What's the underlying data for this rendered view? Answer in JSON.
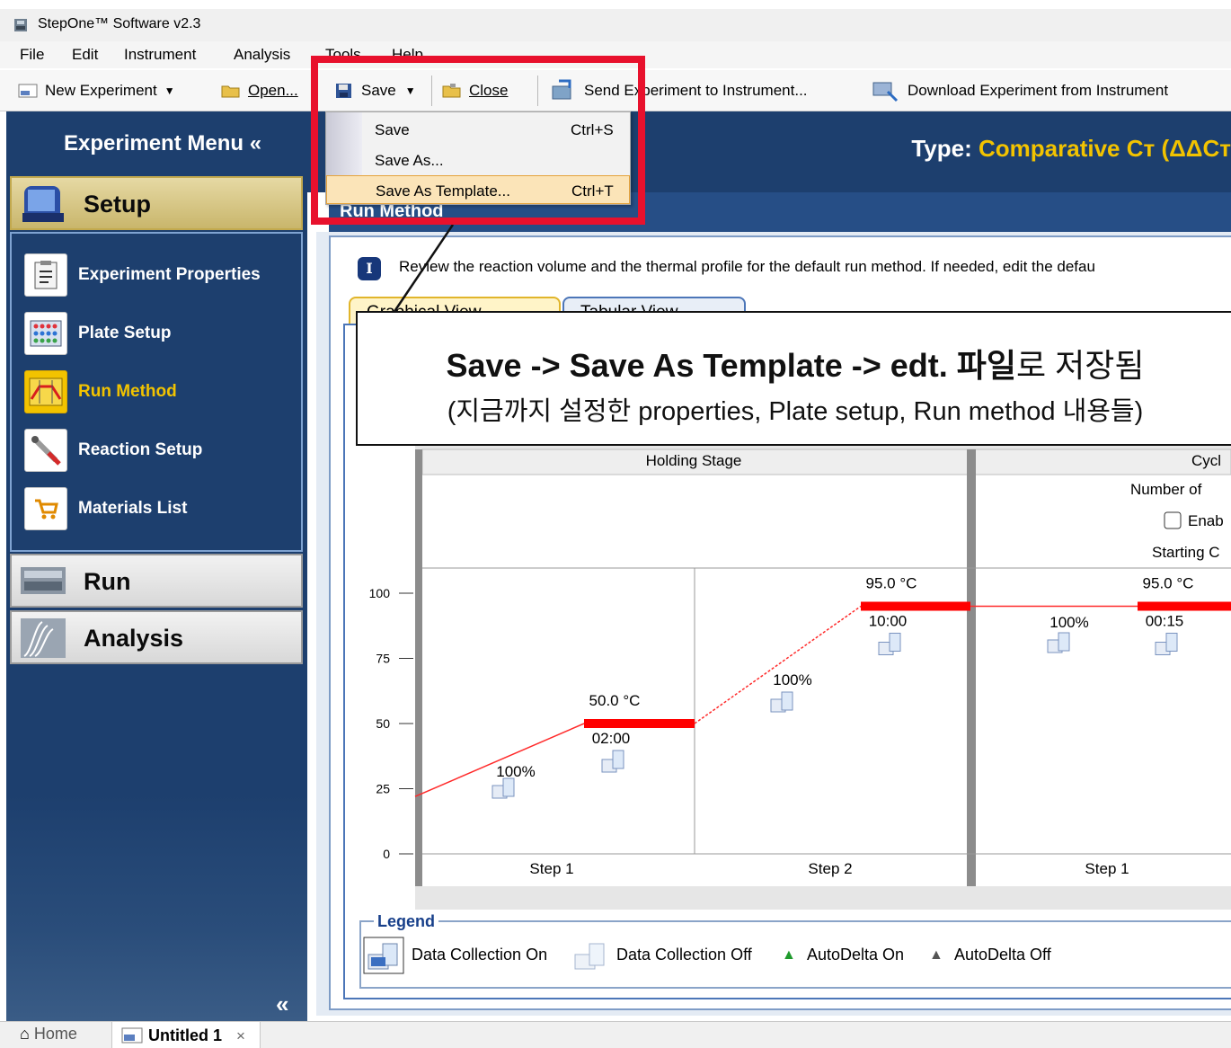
{
  "window": {
    "title": "StepOne™ Software v2.3"
  },
  "menubar": {
    "items": [
      "File",
      "Edit",
      "Instrument",
      "Analysis",
      "Tools",
      "Help"
    ]
  },
  "toolbar": {
    "new_experiment": "New Experiment",
    "open": "Open...",
    "save": "Save",
    "close": "Close",
    "send": "Send Experiment to Instrument...",
    "download": "Download Experiment from Instrument"
  },
  "save_menu": {
    "items": [
      {
        "label": "Save",
        "shortcut": "Ctrl+S"
      },
      {
        "label": "Save As...",
        "shortcut": ""
      },
      {
        "label": "Save As Template...",
        "shortcut": "Ctrl+T"
      }
    ]
  },
  "sidebar": {
    "title": "Experiment Menu",
    "collapse_glyph": "«",
    "setup": "Setup",
    "items": [
      {
        "label": "Experiment Properties",
        "icon": "clipboard-icon"
      },
      {
        "label": "Plate Setup",
        "icon": "plate-icon"
      },
      {
        "label": "Run Method",
        "icon": "run-method-icon"
      },
      {
        "label": "Reaction Setup",
        "icon": "pipette-icon"
      },
      {
        "label": "Materials List",
        "icon": "cart-icon"
      }
    ],
    "run": "Run",
    "analysis": "Analysis",
    "bottom_collapse": "«"
  },
  "header": {
    "type_label": "Type:",
    "type_value": "Comparative Cт (ΔΔCт"
  },
  "panel": {
    "title": "Run Method",
    "info": "Review the reaction volume and the thermal profile for the default run method. If needed, edit the defau",
    "tabs": [
      "Graphical View",
      "Tabular View"
    ]
  },
  "chart_data": {
    "type": "line",
    "ylim": [
      0,
      100
    ],
    "yticks": [
      0,
      25,
      50,
      75,
      100
    ],
    "stages": [
      {
        "name": "Holding Stage",
        "steps": [
          {
            "label": "Step 1",
            "temp": "50.0 °C",
            "time": "02:00",
            "value": 50,
            "ramp": "100%"
          },
          {
            "label": "Step 2",
            "temp": "95.0 °C",
            "time": "10:00",
            "value": 95,
            "ramp": "100%"
          }
        ]
      },
      {
        "name": "Cycl",
        "lines": [
          "Number of",
          "Enab",
          "Starting C"
        ],
        "steps": [
          {
            "label": "Step 1",
            "temp": "95.0 °C",
            "time": "00:15",
            "value": 95,
            "ramp": "100%"
          }
        ]
      }
    ],
    "start_value": 22
  },
  "legend": {
    "title": "Legend",
    "items": [
      "Data Collection On",
      "Data Collection Off",
      "AutoDelta On",
      "AutoDelta Off"
    ]
  },
  "annotation": {
    "line1_bold_a": "Save -> Save As Template -> edt. 파일",
    "line1_rest": "로 저장됨",
    "line2": "(지금까지 설정한 properties, Plate setup, Run method 내용들)"
  },
  "colors": {
    "accent_red": "#e8112d",
    "navy": "#1d3f6e",
    "gold": "#f2c300",
    "step_red": "#ff0000"
  },
  "bottom_tabs": {
    "home": "Home",
    "untitled": "Untitled 1",
    "close": "×"
  }
}
